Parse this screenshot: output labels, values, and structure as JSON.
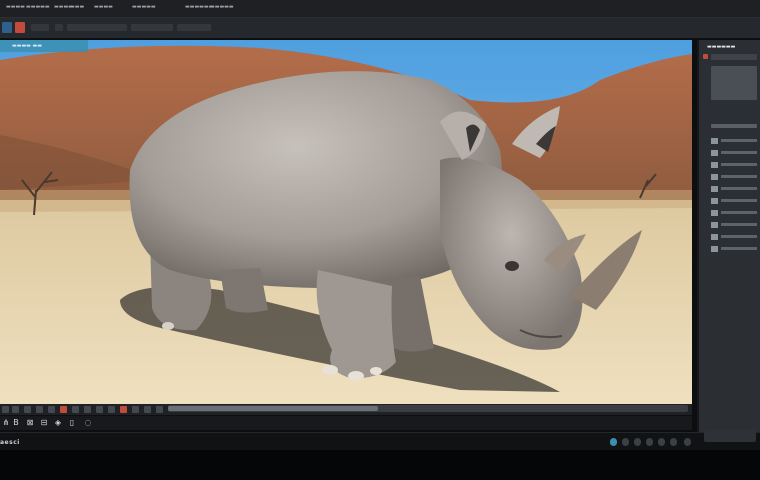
{
  "menubar": {
    "items": [
      "▬▬▬▬",
      "▬▬▬▬▬",
      "▬▬▬▬",
      "▬▬▬",
      "▬▬▬▬",
      "▬▬▬▬▬",
      "▬▬▬▬▬▬",
      "▬▬▬▬▬"
    ]
  },
  "colors": {
    "sky": "#5aa9e6",
    "hills": "#a86a48",
    "sand": "#e7d6b0",
    "rhino": "#a59f9a",
    "tab_accent": "#3c8fb0"
  },
  "document_tab": {
    "label": "▬▬▬▬ ▬▬"
  },
  "panel": {
    "title": "▬▬▬▬▬▬"
  },
  "brand": {
    "text": "aesci"
  },
  "icons": {
    "left_tool": "document-icon",
    "active_tool": "red-square-icon"
  }
}
